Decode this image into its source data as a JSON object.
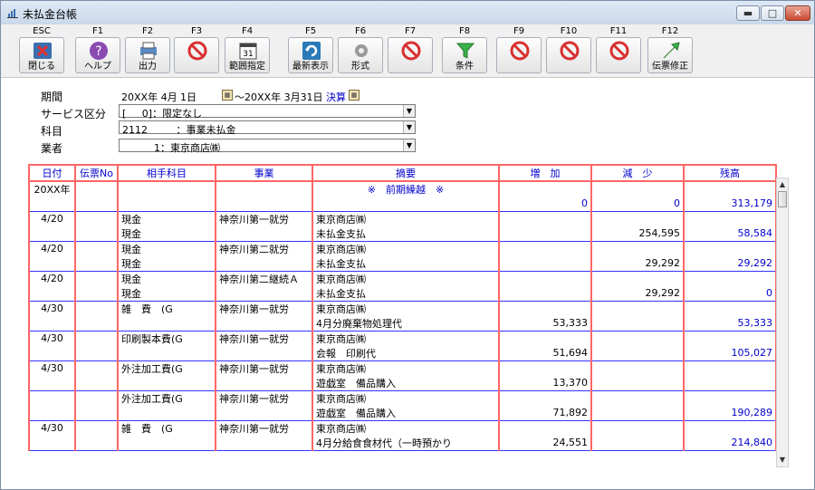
{
  "window": {
    "title": "未払金台帳"
  },
  "toolbar": [
    {
      "key": "ESC",
      "label": "閉じる",
      "icon": "close-icon"
    },
    {
      "key": "F1",
      "label": "ヘルプ",
      "icon": "help-icon"
    },
    {
      "key": "F2",
      "label": "出力",
      "icon": "print-icon"
    },
    {
      "key": "F3",
      "label": "",
      "icon": "disabled-icon"
    },
    {
      "key": "F4",
      "label": "範囲指定",
      "icon": "calendar-icon",
      "icon_text": "31"
    },
    {
      "key": "F5",
      "label": "最新表示",
      "icon": "refresh-icon"
    },
    {
      "key": "F6",
      "label": "形式",
      "icon": "gear-icon"
    },
    {
      "key": "F7",
      "label": "",
      "icon": "disabled-icon"
    },
    {
      "key": "F8",
      "label": "条件",
      "icon": "filter-icon"
    },
    {
      "key": "F9",
      "label": "",
      "icon": "disabled-icon"
    },
    {
      "key": "F10",
      "label": "",
      "icon": "disabled-icon"
    },
    {
      "key": "F11",
      "label": "",
      "icon": "disabled-icon"
    },
    {
      "key": "F12",
      "label": "伝票修正",
      "icon": "edit-arrow-icon"
    }
  ],
  "filters": {
    "period_label": "期間",
    "period_from": "20XX年  4月 1日",
    "period_sep": "～20XX年  3月31日",
    "settlement_link": "決算",
    "service_label": "サービス区分",
    "service_value": "[     0]：限定なし",
    "account_label": "科目",
    "account_value": "2112         ：事業未払金",
    "vendor_label": "業者",
    "vendor_value": "          1：東京商店㈱"
  },
  "table": {
    "headers": [
      "日付",
      "伝票No",
      "相手科目",
      "事業",
      "摘要",
      "増　加",
      "減　少",
      "残高"
    ],
    "rows": [
      {
        "date": "20XX年",
        "voucher": "",
        "contra1": "",
        "contra2": "",
        "business": "",
        "desc1": "※　前期繰越　※",
        "desc2": "",
        "increase": "",
        "decrease1": "",
        "decrease": "0",
        "increase_val": "0",
        "balance": "313,179",
        "carry": true
      },
      {
        "date": "4/20",
        "voucher": "",
        "contra1": "現金",
        "contra2": "現金",
        "business": "神奈川第一就労",
        "desc1": "東京商店㈱",
        "desc2": "未払金支払",
        "increase_val": "",
        "decrease": "254,595",
        "balance": "58,584"
      },
      {
        "date": "4/20",
        "voucher": "",
        "contra1": "現金",
        "contra2": "現金",
        "business": "神奈川第二就労",
        "desc1": "東京商店㈱",
        "desc2": "未払金支払",
        "increase_val": "",
        "decrease": "29,292",
        "balance": "29,292"
      },
      {
        "date": "4/20",
        "voucher": "",
        "contra1": "現金",
        "contra2": "現金",
        "business": "神奈川第二継続Ａ",
        "desc1": "東京商店㈱",
        "desc2": "未払金支払",
        "increase_val": "",
        "decrease": "29,292",
        "balance": "0"
      },
      {
        "date": "4/30",
        "voucher": "",
        "contra1": "雑　費　(G",
        "contra2": "",
        "business": "神奈川第一就労",
        "desc1": "東京商店㈱",
        "desc2": "4月分廃棄物処理代",
        "increase_val": "53,333",
        "decrease": "",
        "balance": "53,333"
      },
      {
        "date": "4/30",
        "voucher": "",
        "contra1": "印刷製本費(G",
        "contra2": "",
        "business": "神奈川第一就労",
        "desc1": "東京商店㈱",
        "desc2": "会報　印刷代",
        "increase_val": "51,694",
        "decrease": "",
        "balance": "105,027"
      },
      {
        "date": "4/30",
        "voucher": "",
        "contra1": "外注加工費(G",
        "contra2": "",
        "business": "神奈川第一就労",
        "desc1": "東京商店㈱",
        "desc2": "遊戯室　備品購入",
        "increase_val": "13,370",
        "decrease": "",
        "balance": ""
      },
      {
        "date": "",
        "voucher": "",
        "contra1": "外注加工費(G",
        "contra2": "",
        "business": "神奈川第一就労",
        "desc1": "東京商店㈱",
        "desc2": "遊戯室　備品購入",
        "increase_val": "71,892",
        "decrease": "",
        "balance": "190,289"
      },
      {
        "date": "4/30",
        "voucher": "",
        "contra1": "雑　費　(G",
        "contra2": "",
        "business": "神奈川第一就労",
        "desc1": "東京商店㈱",
        "desc2": "4月分給食食材代（一時預かり",
        "increase_val": "24,551",
        "decrease": "",
        "balance": "214,840"
      }
    ]
  },
  "colors": {
    "grid_red": "#ff6666",
    "row_blue": "#3333ff",
    "header_text": "#0000cc"
  }
}
